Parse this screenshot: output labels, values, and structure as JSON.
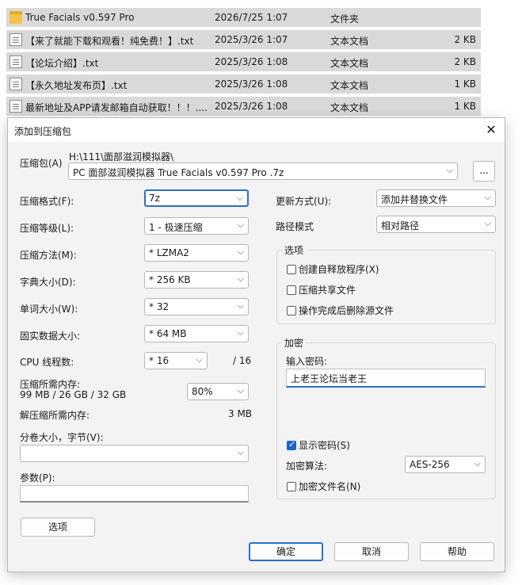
{
  "files": [
    {
      "name": "True Facials v0.597 Pro",
      "date": "2026/7/25 1:07",
      "type": "文件夹",
      "size": "",
      "icon": "folder-icon"
    },
    {
      "name": "【来了就能下载和观看！纯免费！】.txt",
      "date": "2025/3/26 1:07",
      "type": "文本文档",
      "size": "2 KB",
      "icon": "text-file-icon"
    },
    {
      "name": "【论坛介绍】.txt",
      "date": "2025/3/26 1:08",
      "type": "文本文档",
      "size": "2 KB",
      "icon": "text-file-icon"
    },
    {
      "name": "【永久地址发布页】.txt",
      "date": "2025/3/26 1:08",
      "type": "文本文档",
      "size": "1 KB",
      "icon": "text-file-icon"
    },
    {
      "name": "最新地址及APP请发邮箱自动获取！！！....",
      "date": "2025/3/26 1:08",
      "type": "文本文档",
      "size": "1 KB",
      "icon": "text-file-icon"
    }
  ],
  "dialog": {
    "title": "添加到压缩包",
    "close": "✕",
    "archive_label": "压缩包(A)",
    "archive_path": "H:\\111\\面部滋润模拟器\\",
    "archive_name": "PC 面部滋润模拟器 True Facials v0.597 Pro .7z",
    "browse": "...",
    "format_label": "压缩格式(F):",
    "format_value": "7z",
    "level_label": "压缩等级(L):",
    "level_value": "1 - 极速压缩",
    "method_label": "压缩方法(M):",
    "method_value": "*  LZMA2",
    "dict_label": "字典大小(D):",
    "dict_value": "*  256 KB",
    "word_label": "单词大小(W):",
    "word_value": "*  32",
    "solid_label": "固实数据大小:",
    "solid_value": "*  64 MB",
    "cpu_label": "CPU 线程数:",
    "cpu_value": "*  16",
    "cpu_total": "/ 16",
    "mem_label": "压缩所需内存:",
    "mem_value": "99 MB / 26 GB / 32 GB",
    "mem_percent": "80%",
    "decomp_label": "解压缩所需内存:",
    "decomp_value": "3 MB",
    "volume_label": "分卷大小，字节(V):",
    "volume_value": "",
    "params_label": "参数(P):",
    "params_value": "",
    "options_button": "选项",
    "update_label": "更新方式(U):",
    "update_value": "添加并替换文件",
    "path_label": "路径模式",
    "path_value": "相对路径",
    "options_group": "选项",
    "opt_sfx": "创建自释放程序(X)",
    "opt_shared": "压缩共享文件",
    "opt_delete": "操作完成后删除源文件",
    "enc_group": "加密",
    "pwd_label": "输入密码:",
    "pwd_value": "上老王论坛当老王",
    "show_pwd": "显示密码(S)",
    "enc_method_label": "加密算法:",
    "enc_method_value": "AES-256",
    "enc_names": "加密文件名(N)",
    "ok": "确定",
    "cancel": "取消",
    "help": "帮助"
  }
}
